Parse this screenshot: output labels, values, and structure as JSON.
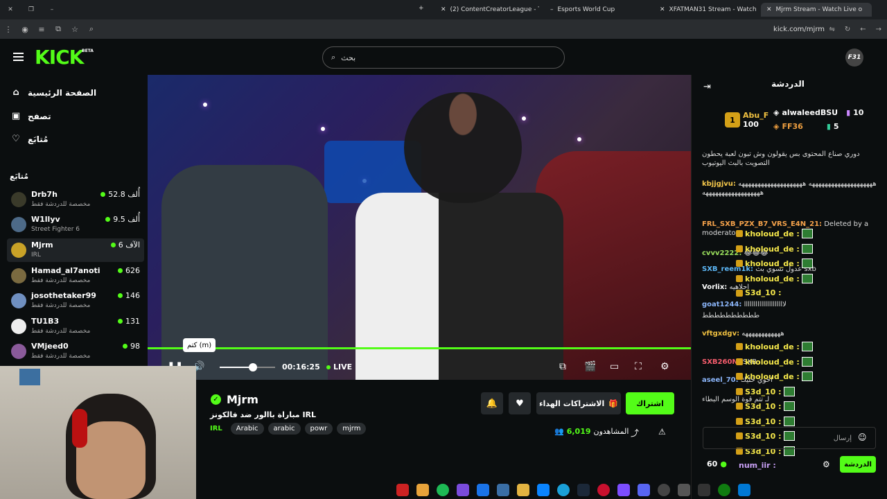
{
  "browser": {
    "tabs": [
      {
        "title": "(2) ContentCreatorLeague - Tw",
        "active": false
      },
      {
        "title": "Esports World Cup",
        "active": false
      },
      {
        "title": "XFATMAN31 Stream - Watch Li",
        "active": false
      },
      {
        "title": "Mjrm Stream - Watch Live o",
        "active": true
      }
    ],
    "url": "kick.com/mjrm"
  },
  "header": {
    "logo": "KICK",
    "beta": "BETA",
    "search_placeholder": "بحث",
    "avatar_text": "F31"
  },
  "sidebar": {
    "nav": [
      {
        "label": "الصفحة الرئيسية",
        "icon": "home-icon"
      },
      {
        "label": "تصفح",
        "icon": "browse-icon"
      },
      {
        "label": "مُتابَع",
        "icon": "heart-icon"
      }
    ],
    "following_header": "مُتابَع",
    "channels": [
      {
        "name": "Drb7h",
        "sub": "مخصصة للدردشة فقط",
        "viewers": "أُلف 52.8",
        "selected": false
      },
      {
        "name": "W1llyv",
        "sub": "Street Fighter 6",
        "viewers": "أُلف 9.5",
        "selected": false
      },
      {
        "name": "Mjrm",
        "sub": "IRL",
        "viewers": "الآف 6",
        "selected": true
      },
      {
        "name": "Hamad_al7anoti",
        "sub": "مخصصة للدردشة فقط",
        "viewers": "626",
        "selected": false
      },
      {
        "name": "josothetaker99",
        "sub": "مخصصة للدردشة فقط",
        "viewers": "146",
        "selected": false
      },
      {
        "name": "TU1B3",
        "sub": "مخصصة للدردشة فقط",
        "viewers": "131",
        "selected": false
      },
      {
        "name": "VMjeed0",
        "sub": "مخصصة للدردشة فقط",
        "viewers": "98",
        "selected": false
      }
    ]
  },
  "player": {
    "tooltip": "كتم (m)",
    "time": "00:16:25",
    "live_label": "LIVE",
    "volume": 0.6,
    "progress": 1.0
  },
  "stream": {
    "name": "Mjrm",
    "title": "مباراة باالور ضد فالكونز IRL",
    "category": "IRL",
    "tags": [
      "Arabic",
      "arabic",
      "powr",
      "mjrm"
    ],
    "subscribe_label": "اشتراك",
    "gift_label": "الاشتراكات الهداء",
    "viewers_count": "6,019",
    "viewers_label": "المشاهدون"
  },
  "chat": {
    "title": "الدردشة",
    "leaders": [
      {
        "rank": "1",
        "name": "Abu_F",
        "amount": "100"
      },
      {
        "name": "alwaleedBSU",
        "amount": "10"
      },
      {
        "name": "FF36",
        "amount": "5"
      }
    ],
    "messages": [
      {
        "user": "",
        "text": "دوري صناع المحتوى بس يقولون وش تبون لعبة يحطون التصويت بالبث اليوتيوب"
      },
      {
        "user": "kbjjgjvu:",
        "text": "ههههههههههههههههههههه ههههههههههههههههههههه ههههههههههههههههههه"
      },
      {
        "user": "FRL_SXB_PZX_B7_VRS_E4N_21:",
        "text": "Deleted by a moderator"
      },
      {
        "user": "cvvv2222:",
        "text": "😂😂😂"
      },
      {
        "user": "SXB_reem1k:",
        "text": "عدول تسوي بث sxb"
      },
      {
        "user": "Vorlix:",
        "text": "احلاهيه"
      },
      {
        "user": "goat1244:",
        "text": "لااااااااااااااااااااا"
      },
      {
        "user": "",
        "text": "طططططططططط"
      },
      {
        "user": "vftgxdgv:",
        "text": "ههههههههههههه"
      },
      {
        "user": "SXB260N:",
        "text": "SXB"
      },
      {
        "user": "aseel_70:",
        "text": "اخوي خليك"
      },
      {
        "user": "",
        "text": "لـ تتم قوة الوسم البطاء"
      }
    ],
    "overlay_users": [
      "kholoud_de :",
      "kholoud_de :",
      "kholoud_de :",
      "kholoud_de :",
      "S3d_10 :",
      "kholoud_de :",
      "kholoud_de :",
      "kholoud_de :",
      "S3d_10 :",
      "S3d_10 :",
      "S3d_10 :",
      "S3d_10 :",
      "S3d_10 :"
    ],
    "input_placeholder": "إرسال",
    "send_label": "الدردشة",
    "points": "60",
    "bottom_user": "num_iir :"
  },
  "colors": {
    "accent": "#53fc18",
    "bg": "#0b0e0f"
  }
}
